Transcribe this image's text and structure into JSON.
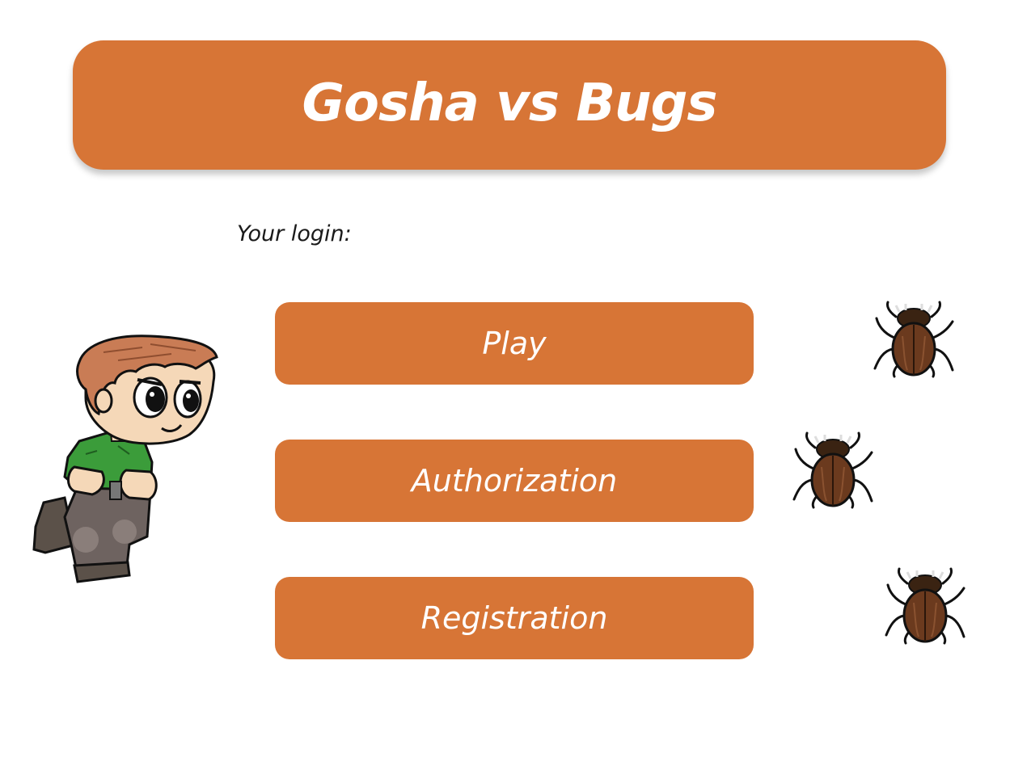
{
  "header": {
    "title": "Gosha vs Bugs"
  },
  "login": {
    "label": "Your login:"
  },
  "menu": {
    "play_label": "Play",
    "authorization_label": "Authorization",
    "registration_label": "Registration"
  },
  "colors": {
    "accent": "#D77536",
    "text_on_accent": "#FFFFFF",
    "beetle_body": "#6B3A1E"
  },
  "sprites": {
    "player": "gosha-character-icon",
    "enemies": [
      "beetle-icon",
      "beetle-icon",
      "beetle-icon"
    ]
  }
}
